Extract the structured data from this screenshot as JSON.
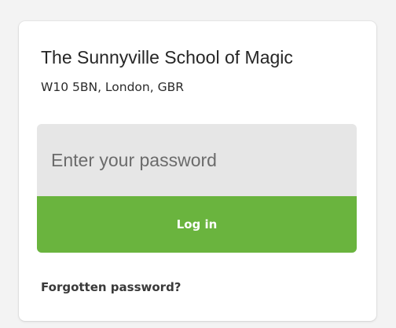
{
  "school": {
    "name": "The Sunnyville School of Magic",
    "address": "W10 5BN, London, GBR"
  },
  "login": {
    "password_placeholder": "Enter your password",
    "password_value": "",
    "button_label": "Log in",
    "forgot_label": "Forgotten password?"
  },
  "colors": {
    "accent": "#6ab43e",
    "input_background": "#e6e6e6",
    "card_background": "#ffffff",
    "page_background": "#f3f3f3"
  }
}
